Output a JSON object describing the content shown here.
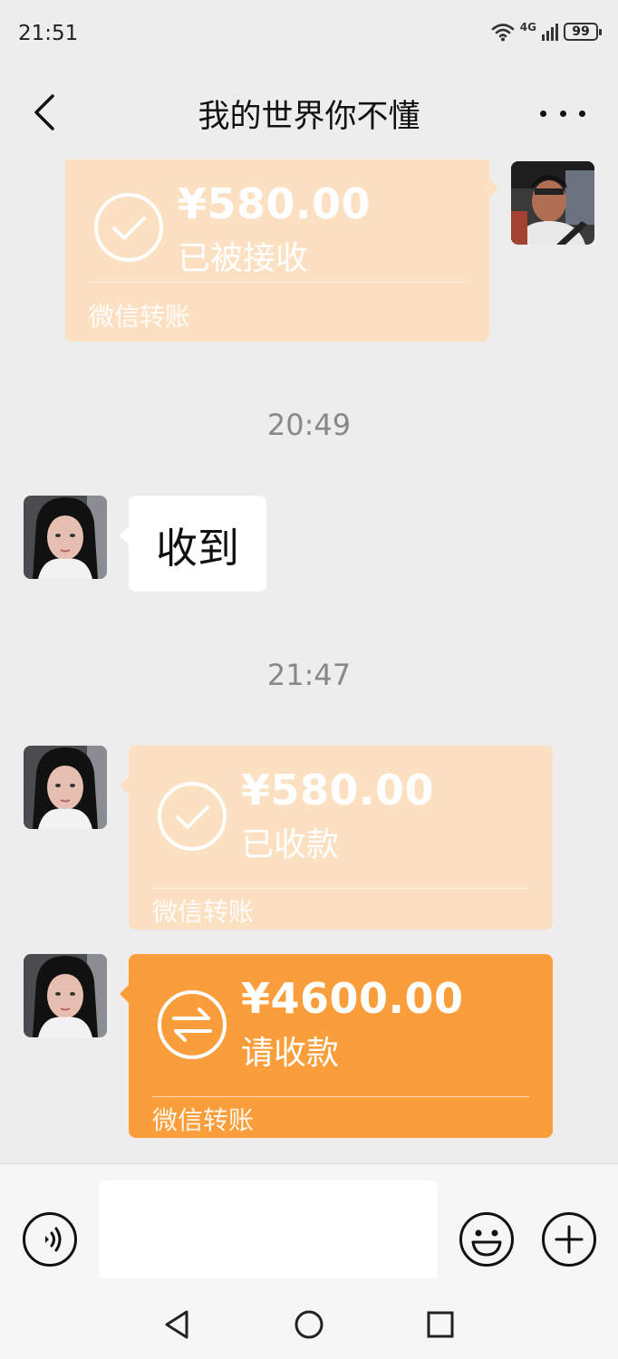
{
  "status_bar": {
    "time": "21:51",
    "network": "4G",
    "battery": "99"
  },
  "header": {
    "title": "我的世界你不懂"
  },
  "messages": [
    {
      "kind": "transfer",
      "side": "right",
      "amount": "¥580.00",
      "status": "已被接收",
      "label": "微信转账",
      "state": "received"
    },
    {
      "kind": "timestamp",
      "text": "20:49"
    },
    {
      "kind": "text",
      "side": "left",
      "text": "收到"
    },
    {
      "kind": "timestamp",
      "text": "21:47"
    },
    {
      "kind": "transfer",
      "side": "left",
      "amount": "¥580.00",
      "status": "已收款",
      "label": "微信转账",
      "state": "received"
    },
    {
      "kind": "transfer",
      "side": "left",
      "amount": "¥4600.00",
      "status": "请收款",
      "label": "微信转账",
      "state": "pending"
    }
  ],
  "input_bar": {
    "placeholder": ""
  },
  "icons": {
    "back": "chevron-left-icon",
    "more": "more-dots-icon",
    "voice": "voice-icon",
    "emoji": "emoji-icon",
    "plus": "plus-icon",
    "check": "check-circle-icon",
    "transfer": "transfer-arrows-icon",
    "nav_back": "nav-back-icon",
    "nav_home": "nav-home-icon",
    "nav_recent": "nav-recent-icon"
  },
  "colors": {
    "background": "#ededed",
    "transfer_received": "#fce0c2",
    "transfer_pending": "#fa9e3b",
    "bubble": "#ffffff"
  }
}
